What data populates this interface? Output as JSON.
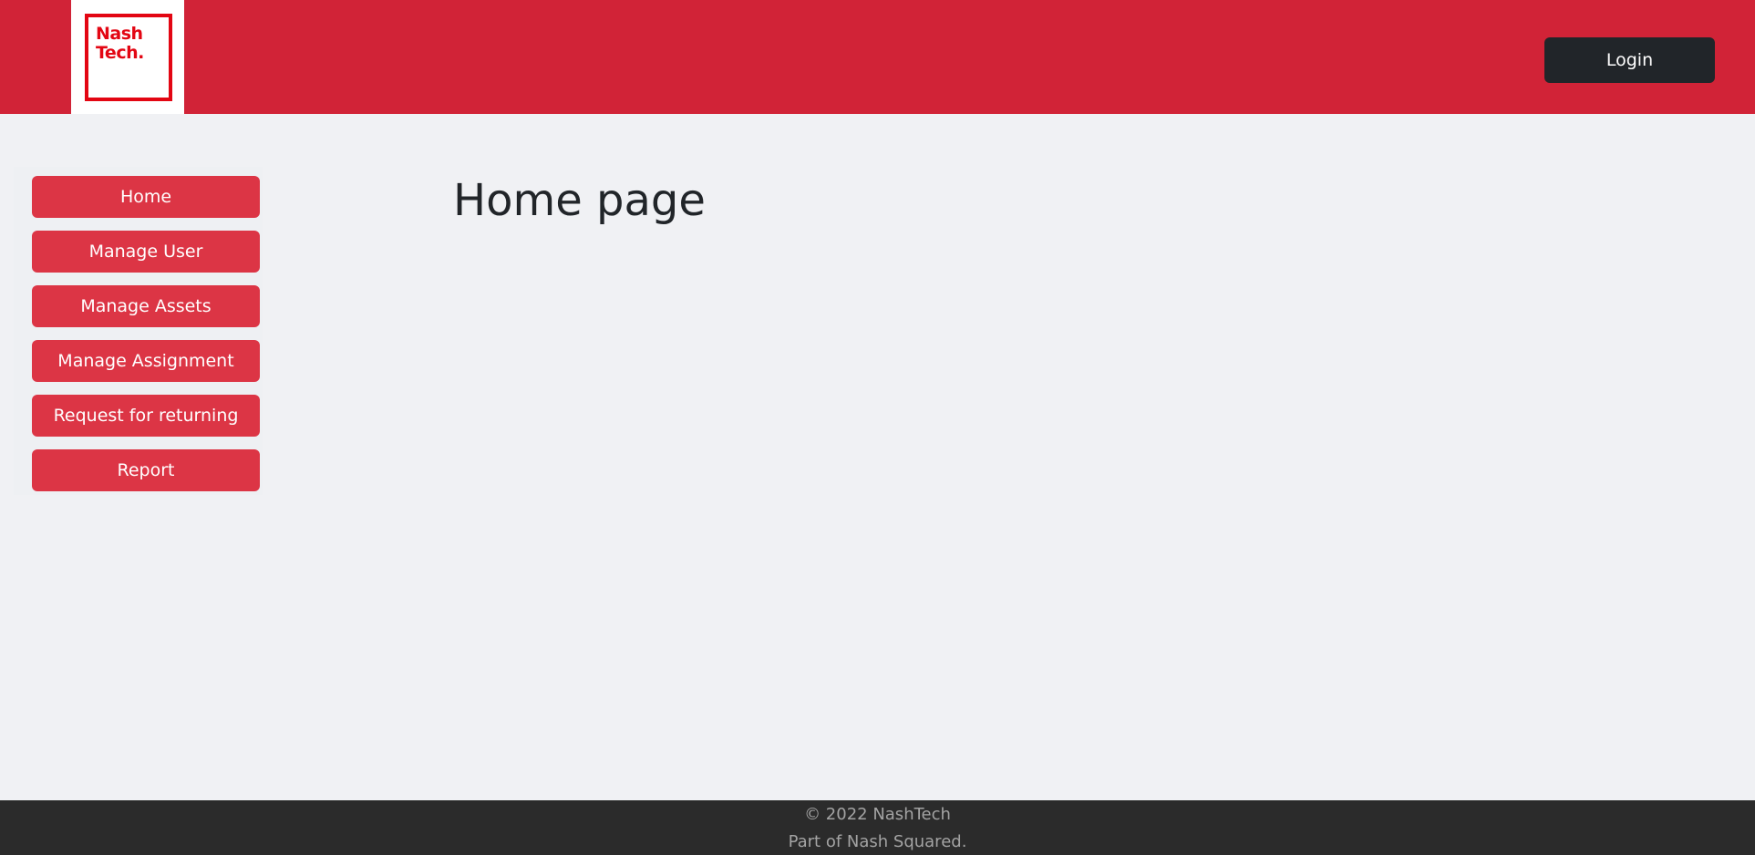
{
  "header": {
    "logo_text_line1": "Nash",
    "logo_text_line2": "Tech.",
    "login_label": "Login",
    "brand_color": "#d12337"
  },
  "sidebar": {
    "items": [
      {
        "label": "Home"
      },
      {
        "label": "Manage User"
      },
      {
        "label": "Manage Assets"
      },
      {
        "label": "Manage Assignment"
      },
      {
        "label": "Request for returning"
      },
      {
        "label": "Report"
      }
    ],
    "button_color": "#dc3545"
  },
  "main": {
    "title": "Home page"
  },
  "footer": {
    "copyright": "© 2022 NashTech",
    "tagline": "Part of Nash Squared."
  }
}
